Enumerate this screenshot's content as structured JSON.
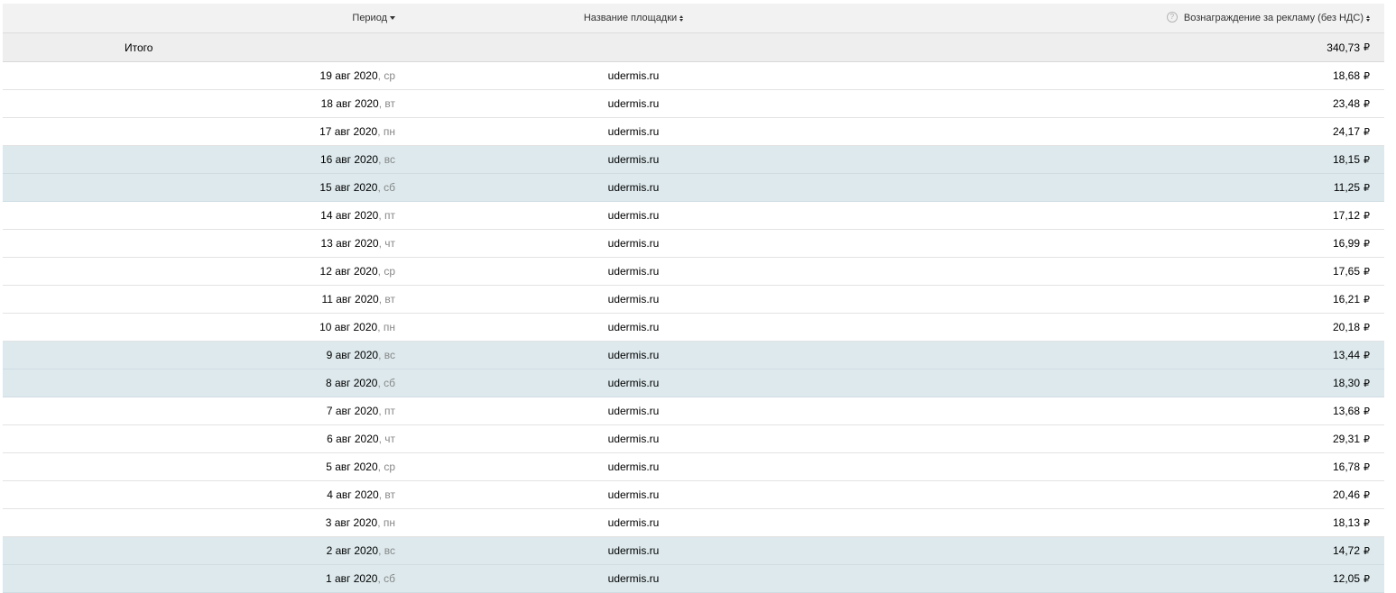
{
  "header": {
    "period_label": "Период",
    "site_label": "Название площадки",
    "reward_label": "Вознаграждение за рекламу (без НДС)",
    "help_glyph": "?"
  },
  "total": {
    "label": "Итого",
    "value": "340,73",
    "currency": "₽"
  },
  "currency": "₽",
  "rows": [
    {
      "date": "19 авг 2020",
      "day": ", ср",
      "site": "udermis.ru",
      "reward": "18,68",
      "weekend": false
    },
    {
      "date": "18 авг 2020",
      "day": ", вт",
      "site": "udermis.ru",
      "reward": "23,48",
      "weekend": false
    },
    {
      "date": "17 авг 2020",
      "day": ", пн",
      "site": "udermis.ru",
      "reward": "24,17",
      "weekend": false
    },
    {
      "date": "16 авг 2020",
      "day": ", вс",
      "site": "udermis.ru",
      "reward": "18,15",
      "weekend": true
    },
    {
      "date": "15 авг 2020",
      "day": ", сб",
      "site": "udermis.ru",
      "reward": "11,25",
      "weekend": true
    },
    {
      "date": "14 авг 2020",
      "day": ", пт",
      "site": "udermis.ru",
      "reward": "17,12",
      "weekend": false
    },
    {
      "date": "13 авг 2020",
      "day": ", чт",
      "site": "udermis.ru",
      "reward": "16,99",
      "weekend": false
    },
    {
      "date": "12 авг 2020",
      "day": ", ср",
      "site": "udermis.ru",
      "reward": "17,65",
      "weekend": false
    },
    {
      "date": "11 авг 2020",
      "day": ", вт",
      "site": "udermis.ru",
      "reward": "16,21",
      "weekend": false
    },
    {
      "date": "10 авг 2020",
      "day": ", пн",
      "site": "udermis.ru",
      "reward": "20,18",
      "weekend": false
    },
    {
      "date": "9 авг 2020",
      "day": ", вс",
      "site": "udermis.ru",
      "reward": "13,44",
      "weekend": true
    },
    {
      "date": "8 авг 2020",
      "day": ", сб",
      "site": "udermis.ru",
      "reward": "18,30",
      "weekend": true
    },
    {
      "date": "7 авг 2020",
      "day": ", пт",
      "site": "udermis.ru",
      "reward": "13,68",
      "weekend": false
    },
    {
      "date": "6 авг 2020",
      "day": ", чт",
      "site": "udermis.ru",
      "reward": "29,31",
      "weekend": false
    },
    {
      "date": "5 авг 2020",
      "day": ", ср",
      "site": "udermis.ru",
      "reward": "16,78",
      "weekend": false
    },
    {
      "date": "4 авг 2020",
      "day": ", вт",
      "site": "udermis.ru",
      "reward": "20,46",
      "weekend": false
    },
    {
      "date": "3 авг 2020",
      "day": ", пн",
      "site": "udermis.ru",
      "reward": "18,13",
      "weekend": false
    },
    {
      "date": "2 авг 2020",
      "day": ", вс",
      "site": "udermis.ru",
      "reward": "14,72",
      "weekend": true
    },
    {
      "date": "1 авг 2020",
      "day": ", сб",
      "site": "udermis.ru",
      "reward": "12,05",
      "weekend": true
    }
  ]
}
